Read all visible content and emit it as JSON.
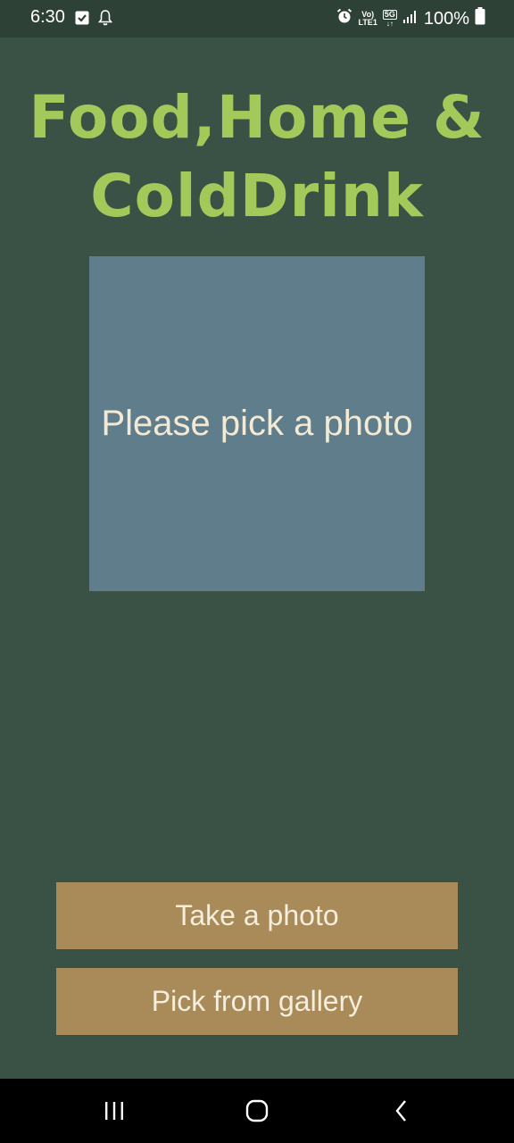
{
  "status_bar": {
    "time": "6:30",
    "battery_percent": "100%",
    "network_top": "Vo)",
    "network_bottom": "LTE1",
    "signal_type": "5G",
    "icons": [
      "check-square-icon",
      "bell-icon",
      "alarm-icon",
      "signal-icon",
      "battery-icon"
    ]
  },
  "app": {
    "title": "Food,Home & ColdDrink",
    "title_color": "#a3c95a",
    "background_color": "#3a5246"
  },
  "photo_area": {
    "placeholder_text": "Please pick a photo",
    "background_color": "#607d8b"
  },
  "buttons": {
    "take_photo": "Take a photo",
    "pick_gallery": "Pick from gallery",
    "color": "#a88b58"
  },
  "nav_bar": {
    "icons": [
      "recent-apps-icon",
      "home-icon",
      "back-icon"
    ]
  }
}
